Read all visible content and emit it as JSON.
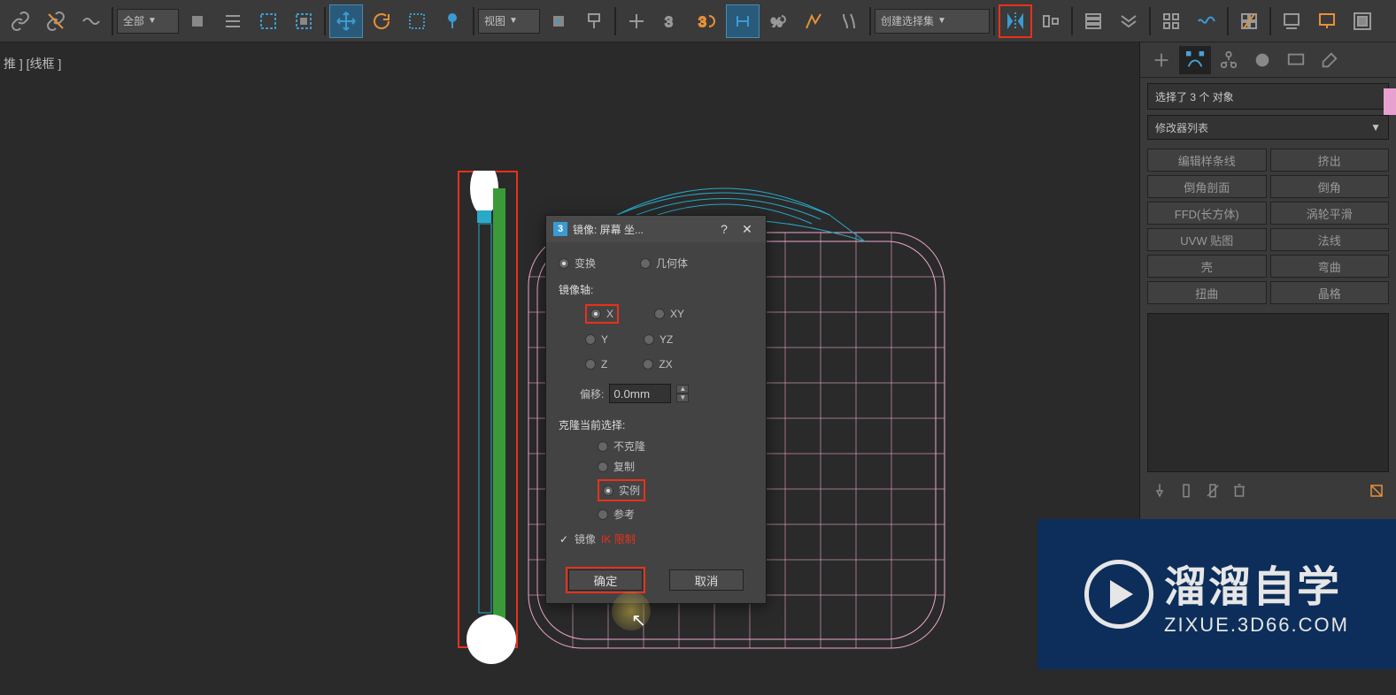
{
  "toolbar": {
    "dropdown_all": "全部",
    "dropdown_view": "视图",
    "dropdown_selection_set": "创建选择集"
  },
  "viewport": {
    "label": "推 ] [线框 ]"
  },
  "dialog": {
    "title": "镜像: 屏幕 坐...",
    "transform": "变换",
    "geometry": "几何体",
    "mirror_axis_label": "镜像轴:",
    "axis_x": "X",
    "axis_y": "Y",
    "axis_z": "Z",
    "axis_xy": "XY",
    "axis_yz": "YZ",
    "axis_zx": "ZX",
    "offset_label": "偏移:",
    "offset_value": "0.0mm",
    "clone_label": "克隆当前选择:",
    "no_clone": "不克隆",
    "copy": "复制",
    "instance": "实例",
    "reference": "参考",
    "mirror_ik": "镜像",
    "ik_limit": "IK 限制",
    "ok": "确定",
    "cancel": "取消"
  },
  "right_panel": {
    "selection_info": "选择了 3 个 对象",
    "modifier_list": "修改器列表",
    "modifiers": {
      "edit_spline": "编辑样条线",
      "extrude": "挤出",
      "bevel_profile": "倒角剖面",
      "bevel": "倒角",
      "ffd_box": "FFD(长方体)",
      "turbosmooth": "涡轮平滑",
      "uvw_map": "UVW 贴图",
      "normal": "法线",
      "shell": "壳",
      "bend": "弯曲",
      "twist": "扭曲",
      "lattice": "晶格"
    }
  },
  "watermark": {
    "main": "溜溜自学",
    "sub": "ZIXUE.3D66.COM"
  }
}
